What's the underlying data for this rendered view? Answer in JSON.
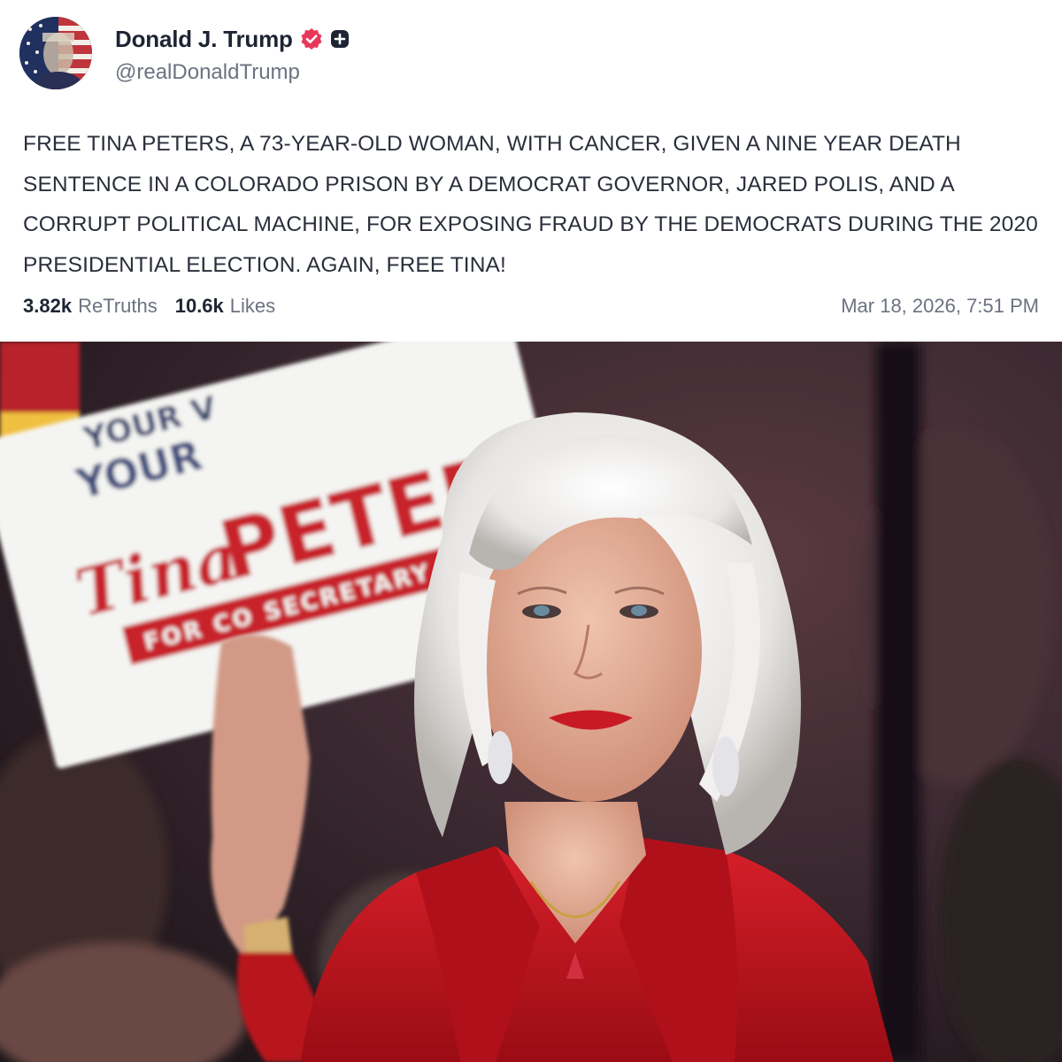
{
  "author": {
    "display_name": "Donald J. Trump",
    "handle": "@realDonaldTrump",
    "verified_icon": "verified-badge-icon",
    "plus_icon": "plus-badge-icon"
  },
  "post": {
    "text": "FREE TINA PETERS, A 73-YEAR-OLD WOMAN, WITH CANCER, GIVEN A NINE YEAR DEATH SENTENCE IN A COLORADO PRISON BY A DEMOCRAT GOVERNOR, JARED POLIS, AND A CORRUPT POLITICAL MACHINE, FOR EXPOSING FRAUD BY THE DEMOCRATS DURING THE 2020 PRESIDENTIAL ELECTION. AGAIN, FREE TINA!",
    "retruths_count": "3.82k",
    "retruths_label": "ReTruths",
    "likes_count": "10.6k",
    "likes_label": "Likes",
    "timestamp": "Mar 18, 2026, 7:51 PM"
  },
  "media": {
    "sign_text_top": "YOUR",
    "sign_text_top2": "YOUR V",
    "sign_name_first": "Tina",
    "sign_name_last": "PETERS",
    "sign_banner": "FOR CO SECRETARY OF STATE"
  },
  "colors": {
    "verified": "#e8385a",
    "text": "#2a2f3b",
    "muted": "#6c7280",
    "sign_red": "#c8202a",
    "jacket_red": "#c8141c"
  }
}
